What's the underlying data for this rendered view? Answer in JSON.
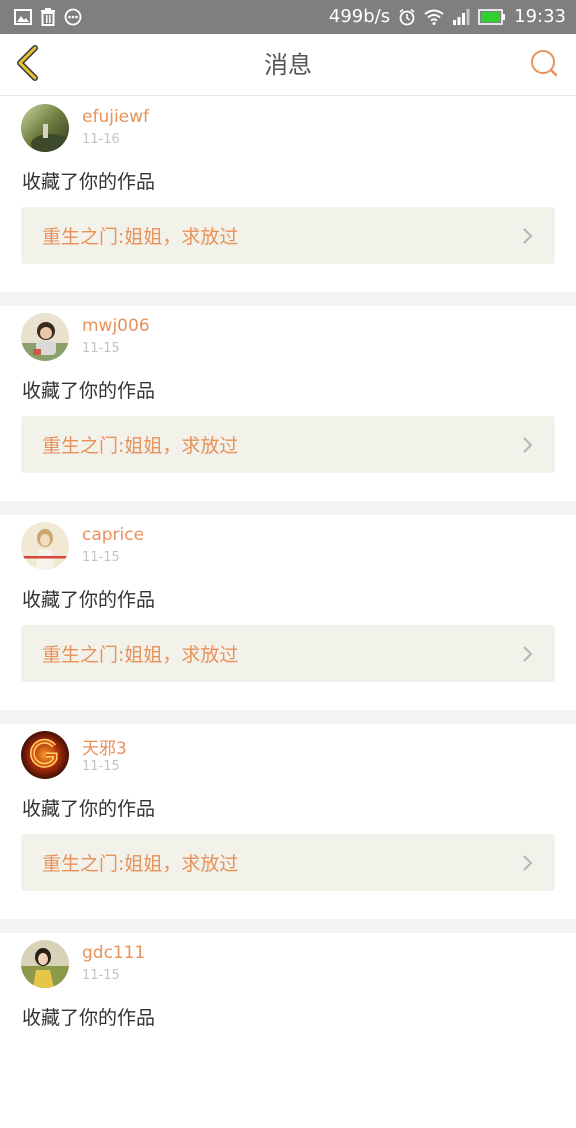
{
  "status_bar": {
    "speed": "499b/s",
    "time": "19:33",
    "icons": [
      "image-icon",
      "trash-icon",
      "dots-icon",
      "alarm-icon",
      "wifi-icon",
      "signal-icon",
      "battery-icon"
    ]
  },
  "header": {
    "title": "消息",
    "back_icon": "chevron-left-icon",
    "search_icon": "search-icon"
  },
  "colors": {
    "accent": "#e8925a",
    "back_icon": "#e8c233",
    "link_background": "#f2f1ea",
    "separator": "#f4f4f2"
  },
  "messages": [
    {
      "username": "efujiewf",
      "date": "11-16",
      "action": "收藏了你的作品",
      "work_title": "重生之门:姐姐，求放过"
    },
    {
      "username": "mwj006",
      "date": "11-15",
      "action": "收藏了你的作品",
      "work_title": "重生之门:姐姐，求放过"
    },
    {
      "username": "caprice",
      "date": "11-15",
      "action": "收藏了你的作品",
      "work_title": "重生之门:姐姐，求放过"
    },
    {
      "username": "天邪3",
      "date": "11-15",
      "action": "收藏了你的作品",
      "work_title": "重生之门:姐姐，求放过"
    },
    {
      "username": "gdc111",
      "date": "11-15",
      "action": "收藏了你的作品"
    }
  ]
}
